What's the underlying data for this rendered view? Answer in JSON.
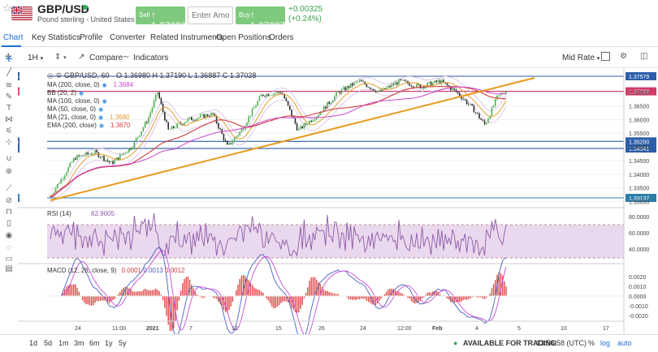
{
  "header": {
    "pair": "GBP/USD",
    "description": "Pound sterling - United States dollar",
    "sell_label": "Sell",
    "sell_price": "1.37028",
    "amount_placeholder": "Enter Amount",
    "buy_label": "Buy",
    "buy_price": "1.37037",
    "change_abs": "+0.00325",
    "change_pct": "(+0.24%)"
  },
  "tabs": [
    {
      "label": "Chart",
      "active": true
    },
    {
      "label": "Key Statistics"
    },
    {
      "label": "Profile"
    },
    {
      "label": "Converter"
    },
    {
      "label": "Related Instruments"
    },
    {
      "label": "Open Positions"
    },
    {
      "label": "Orders"
    }
  ],
  "toolbar": {
    "interval": "1H",
    "compare_label": "Compare",
    "indicators_label": "Indicators",
    "price_type": "Mid Rate"
  },
  "legend": {
    "symbol": "GBP/USD, 60",
    "open": "O 1.36980",
    "high": "H 1.37190",
    "low": "L 1.36887",
    "close": "C 1.37028",
    "indicators": [
      {
        "label": "MA (200, close, 0)",
        "value": "1.3684",
        "color": "#cc44cc"
      },
      {
        "label": "BB (20, 2)",
        "value": "",
        "color": "#888"
      },
      {
        "label": "MA (100, close, 0)",
        "value": "",
        "color": "#888"
      },
      {
        "label": "MA (50, close, 0)",
        "value": "",
        "color": "#888"
      },
      {
        "label": "MA (21, close, 0)",
        "value": "1.3680",
        "color": "#e39b2f"
      },
      {
        "label": "EMA (200, close)",
        "value": "1.3670",
        "color": "#d23b3b"
      }
    ]
  },
  "price_axis": {
    "ticks": [
      "1.37000",
      "1.36500",
      "1.36000",
      "1.35500",
      "1.35000",
      "1.34500",
      "1.34000",
      "1.33500",
      "1.33000"
    ],
    "markers": [
      {
        "value": "1.37579",
        "color": "#2b5ea8"
      },
      {
        "value": "1.37028",
        "color": "#d23b6b"
      },
      {
        "value": "1.35200",
        "color": "#2b5ea8"
      },
      {
        "value": "1.34941",
        "color": "#2b5ea8"
      },
      {
        "value": "1.33137",
        "color": "#2b7ea8"
      }
    ]
  },
  "rsi": {
    "label": "RSI (14)",
    "value": "62.9005",
    "ticks": [
      "80.0000",
      "60.0000",
      "40.0000"
    ]
  },
  "macd": {
    "label": "MACD (12, 26, close, 9)",
    "value1": "0.0001",
    "value2": "0.0013",
    "value3": "0.0012",
    "ticks": [
      "0.0020",
      "0.0010",
      "0.0000",
      "-0.0010",
      "-0.0020"
    ]
  },
  "time_axis": [
    "24",
    "11:00",
    "2021",
    "7",
    "12",
    "15",
    "26",
    "24",
    "12:00",
    "Feb",
    "4",
    "5",
    "10",
    "17"
  ],
  "bottom": {
    "ranges": [
      "1d",
      "5d",
      "1m",
      "3m",
      "6m",
      "1y",
      "5y"
    ],
    "status": "AVAILABLE FOR TRADING",
    "time": "13:56:58 (UTC)",
    "pct": "%",
    "log": "log",
    "auto": "auto"
  },
  "colors": {
    "accent": "#1f6ed4",
    "buy_sell": "#7fc97f",
    "up": "#3aa34a",
    "candle_up": "#4caf50",
    "candle_down": "#2d2d2d",
    "trendline": "#e89a1e",
    "rsi_band": "#ead9ee",
    "rsi_line": "#8e5aa8",
    "macd_line": "#4a5fc1",
    "signal_line": "#c94bd6"
  }
}
